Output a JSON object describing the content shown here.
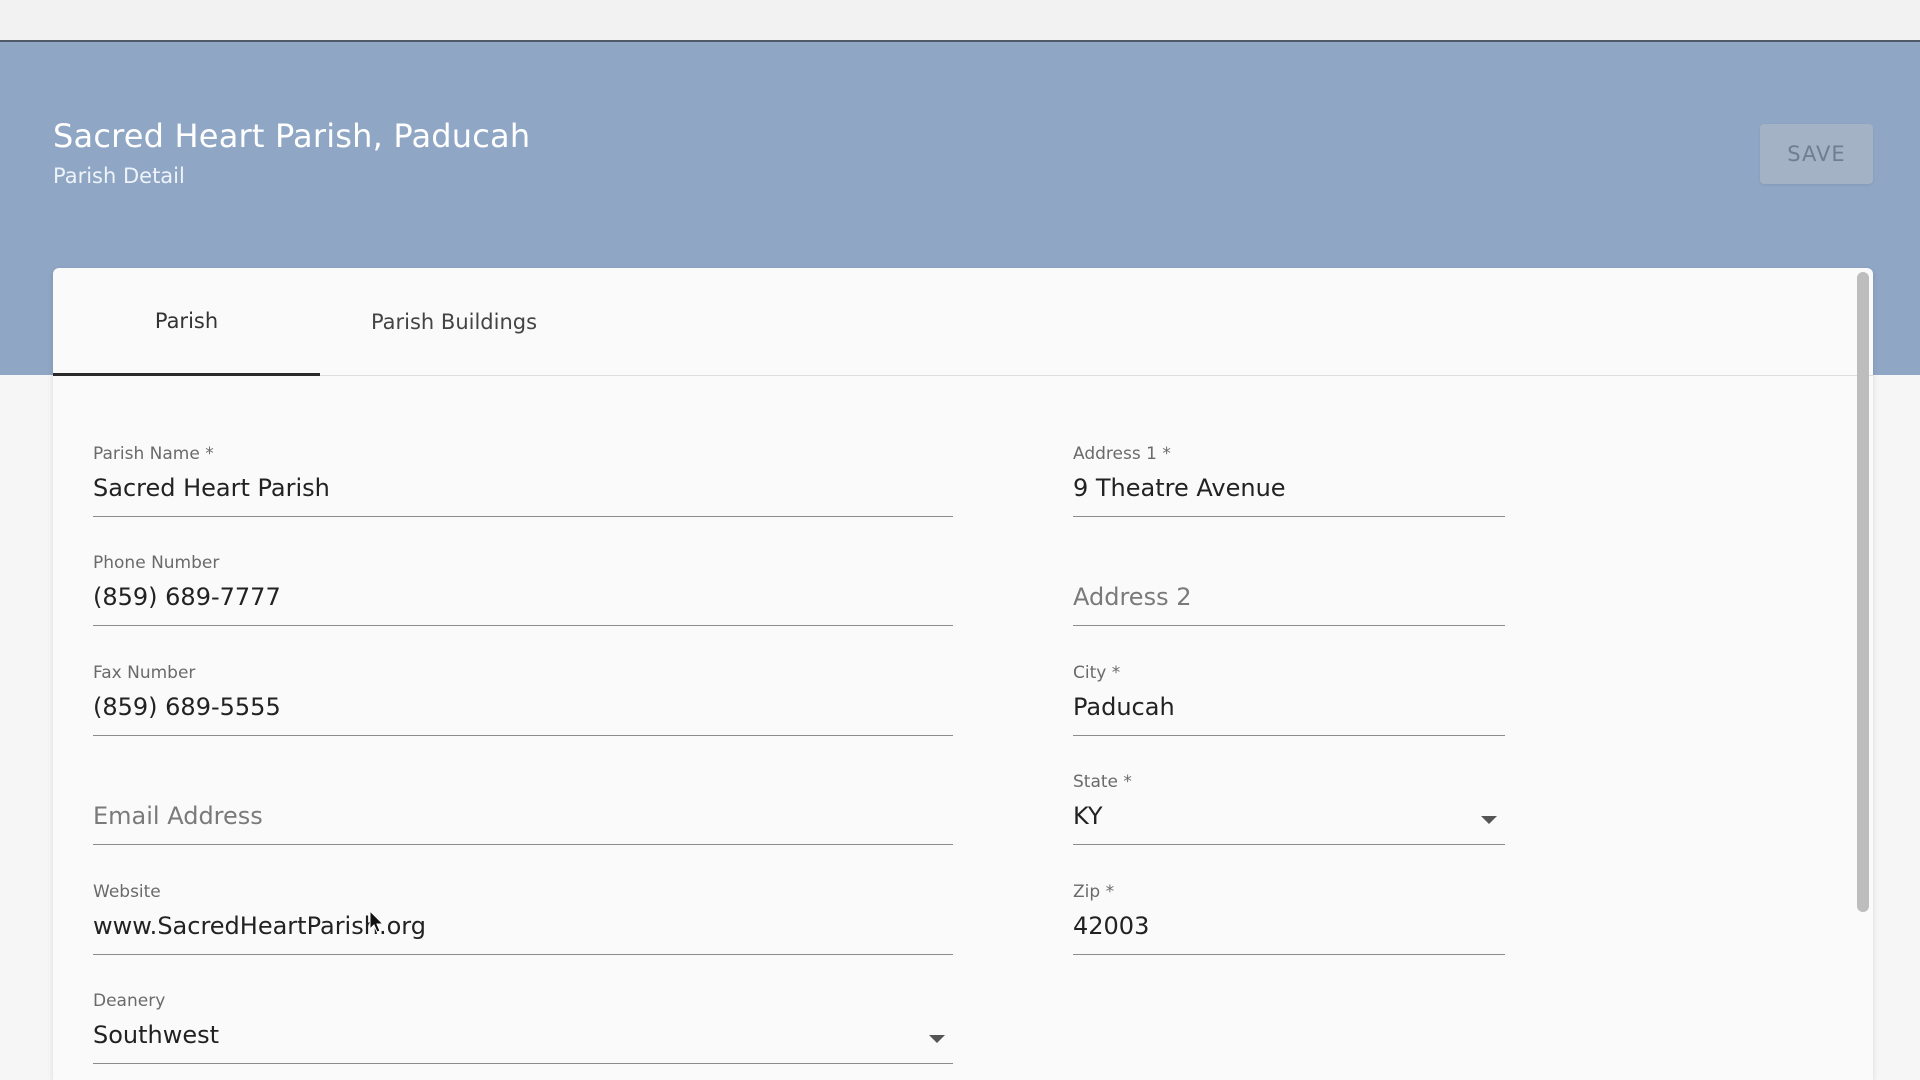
{
  "header": {
    "title": "Sacred Heart Parish, Paducah",
    "subtitle": "Parish Detail",
    "save_label": "SAVE"
  },
  "tabs": [
    {
      "label": "Parish",
      "active": true
    },
    {
      "label": "Parish Buildings",
      "active": false
    }
  ],
  "form": {
    "parish_name": {
      "label": "Parish Name *",
      "value": "Sacred Heart Parish"
    },
    "phone_number": {
      "label": "Phone Number",
      "value": "(859) 689-7777"
    },
    "fax_number": {
      "label": "Fax Number",
      "value": "(859) 689-5555"
    },
    "email_address": {
      "label": "",
      "value": "",
      "placeholder": "Email Address"
    },
    "website": {
      "label": "Website",
      "value": "www.SacredHeartParish.org"
    },
    "deanery": {
      "label": "Deanery",
      "value": "Southwest"
    },
    "address1": {
      "label": "Address 1 *",
      "value": "9 Theatre Avenue"
    },
    "address2": {
      "label": "",
      "value": "",
      "placeholder": "Address 2"
    },
    "city": {
      "label": "City *",
      "value": "Paducah"
    },
    "state": {
      "label": "State *",
      "value": "KY"
    },
    "zip": {
      "label": "Zip *",
      "value": "42003"
    }
  },
  "colors": {
    "banner": "#8fa6c5",
    "save_button_disabled": "#a3b2c5",
    "active_tab_underline": "#2a2a2a"
  },
  "icons": {
    "dropdown": "chevron-down-icon",
    "cursor": "mouse-pointer-icon"
  }
}
